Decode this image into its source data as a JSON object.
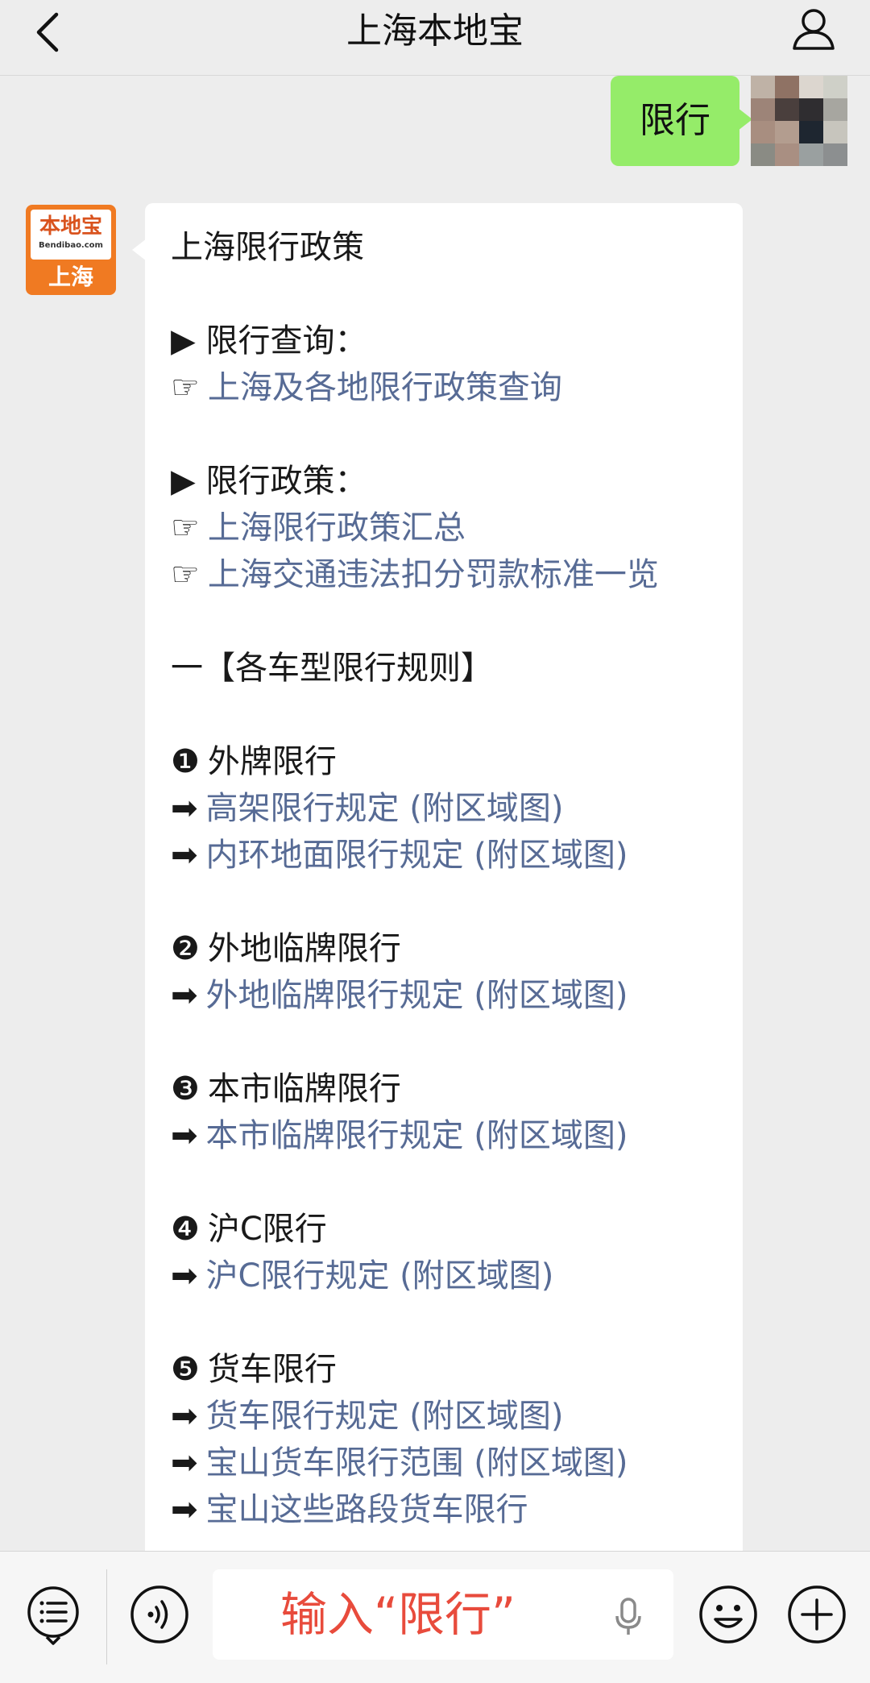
{
  "header": {
    "title": "上海本地宝"
  },
  "sent_message": {
    "text": "限行"
  },
  "bot_avatar": {
    "brand": "本地宝",
    "domain": "Bendibao.com",
    "city": "上海"
  },
  "bot_message": {
    "title": "上海限行政策",
    "section_query": {
      "heading": "▶ 限行查询：",
      "links": [
        "上海及各地限行政策查询"
      ]
    },
    "section_policy": {
      "heading": "▶ 限行政策：",
      "links": [
        "上海限行政策汇总",
        "上海交通违法扣分罚款标准一览"
      ]
    },
    "rules_heading": "一【各车型限行规则】",
    "groups": [
      {
        "marker": "❶",
        "title": "外牌限行",
        "links": [
          "高架限行规定 (附区域图)",
          "内环地面限行规定 (附区域图)"
        ]
      },
      {
        "marker": "❷",
        "title": "外地临牌限行",
        "links": [
          "外地临牌限行规定 (附区域图)"
        ]
      },
      {
        "marker": "❸",
        "title": "本市临牌限行",
        "links": [
          "本市临牌限行规定 (附区域图)"
        ]
      },
      {
        "marker": "❹",
        "title": "沪C限行",
        "links": [
          "沪C限行规定 (附区域图)"
        ]
      },
      {
        "marker": "❺",
        "title": "货车限行",
        "links": [
          "货车限行规定 (附区域图)",
          "宝山货车限行范围 (附区域图)",
          "宝山这些路段货车限行"
        ]
      }
    ],
    "link_pointer": "☞",
    "link_arrow": "➡"
  },
  "input": {
    "value": "输入“限行”"
  },
  "icons": {
    "back": "chevron-left-icon",
    "profile": "person-icon",
    "menu": "list-menu-icon",
    "voice": "voice-icon",
    "mic": "microphone-icon",
    "emoji": "emoji-icon",
    "plus": "plus-icon"
  },
  "colors": {
    "background": "#ededed",
    "sent_bubble": "#95ec69",
    "link": "#576b95",
    "input_text": "#e84b3c",
    "brand_orange": "#f07a22"
  }
}
